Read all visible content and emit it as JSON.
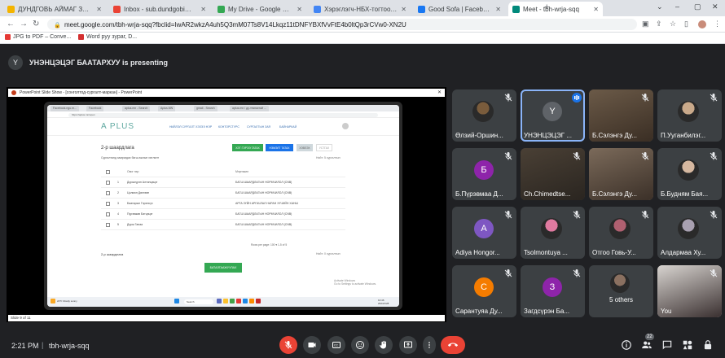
{
  "tabs": [
    {
      "label": "ДУНДГОВЬ АЙМАГ ЗДТГ",
      "favicon_color": "#f4b400",
      "active": false
    },
    {
      "label": "Inbox - sub.dundgobi@gmai",
      "favicon_color": "#ea4335",
      "active": false
    },
    {
      "label": "My Drive - Google Drive",
      "favicon_color": "#34a853",
      "active": false
    },
    {
      "label": "Хэрэглэгч-НБХ-тогтоол-III-у",
      "favicon_color": "#4285f4",
      "active": false
    },
    {
      "label": "Good Sofa | Facebook",
      "favicon_color": "#1877f2",
      "active": false
    },
    {
      "label": "Meet - tbh-wrja-sqq",
      "favicon_color": "#00897b",
      "active": true
    }
  ],
  "address": {
    "url": "meet.google.com/tbh-wrja-sqq?fbclid=IwAR2wkzA4uh5Q3mM07Ts8V14Lkqz11tDNFYBXfVvFtE4b0ltQp3rCVw0-XN2U"
  },
  "bookmarks": [
    {
      "label": "JPG to PDF – Conve...",
      "color": "#e53935"
    },
    {
      "label": "Word руу зураг, D...",
      "color": "#d32f2f"
    }
  ],
  "presenter": {
    "initial": "Y",
    "text": "УНЭНЦЭЦЭГ БААТАРХУУ is presenting"
  },
  "shared_screen": {
    "window_title": "PowerPoint Slide Show - [сонголтод-сургалт-маркан] - PowerPoint",
    "status": "Slide 9 of 11",
    "browser_tabs": [
      "Facebook.ngu.m...",
      "Facebook",
      "aplus.mn - Search",
      "Aplus.MN",
      "gmail - Search",
      "aplus.mn / ду-текниктай ..."
    ],
    "browser_url": "https://aplus.mn/open",
    "logo": "A PLUS",
    "nav": [
      "НИЙЛЭЛ СУРГАЛТ",
      "ХЭЗЭЭ НЭР",
      "КОНТОРСТУРС",
      "СУРГАЛТЫН ЗАЯ",
      "БАЙНАРКАЙ"
    ],
    "section_title": "2-р шаардлага",
    "buttons": [
      {
        "label": "ХЭТ ГЭРЭЭ ТАТАХ",
        "color": "#34a853"
      },
      {
        "label": "НЭМЭЛТ ТАТАХ",
        "color": "#1a73e8"
      },
      {
        "label": "ХЭВЛЭХ",
        "color": "#cfd8dc"
      },
      {
        "label": "УСТГАХ",
        "color": "#ffffff"
      }
    ],
    "subtitle": "Сургалтанд хамрагдах багш ажлын хөтлөлт",
    "subtitle_right": "Нийт: 5 сургалтын",
    "table_header": [
      "Овог нэр",
      "Мэргэжил"
    ],
    "rows": [
      {
        "n": "1",
        "name": "Доржсүрэн Алтанцэцэг",
        "major": "БАГШ ШААРДЛАГЫН НОРМЧИЛОЛ (CNB)"
      },
      {
        "n": "2",
        "name": "Цолмон Дөлгөөн",
        "major": "БАГШ ШААРДЛАГЫН НОРМЧИЛОЛ (CNB)"
      },
      {
        "n": "3",
        "name": "Баатарын Гэрэлсүх",
        "major": "АРГА ЗҮЙН АРГАЧЛАЛ НАРАН ХҮЧИЙН ХАНШ"
      },
      {
        "n": "4",
        "name": "Пүрэвжав Батцэцэг",
        "major": "БАГШ ШААРДЛАГЫН НОРМЧИЛОЛ (CNB)"
      },
      {
        "n": "5",
        "name": "Дорж Ганаа",
        "major": "БАГШ ШААРДЛАГЫН НОРМЧИЛОЛ (CNB)"
      }
    ],
    "pager": "Rows per page: 100 ▾   1-5 of 5",
    "section2_title": "2-р шаардлага",
    "section2_right": "Нийт: 0 сургалтын",
    "confirm_button": "БАТАЛГААЖУУЛАХ",
    "windows_activate": [
      "Activate Windows",
      "Go to Settings to activate Windows."
    ],
    "taskbar_search": "Search",
    "taskbar_weather": "22°F Mostly sunny",
    "taskbar_clock": [
      "10:46",
      "2024/1/28"
    ]
  },
  "participants": [
    {
      "name": "Өлзий-Оршин...",
      "initial": "",
      "kind": "photo",
      "bg": "#3c4043",
      "color": "#7a5c3c",
      "muted": true
    },
    {
      "name": "УНЭНЦЭЦЭГ ...",
      "initial": "Y",
      "kind": "speaking",
      "bg": "#3c4043",
      "color": "#5f6368",
      "muted": false
    },
    {
      "name": "Б.Сэлэнгэ Ду...",
      "initial": "",
      "kind": "video",
      "bg": "#6b5a48",
      "color": "#3a2e24",
      "muted": true
    },
    {
      "name": "П.Ууганбилэг...",
      "initial": "",
      "kind": "photo",
      "bg": "#3c4043",
      "color": "#c9a98a",
      "muted": true
    },
    {
      "name": "Б.Пүрэвмаа Д...",
      "initial": "Б",
      "kind": "avatar",
      "bg": "#3c4043",
      "color": "#8e24aa",
      "muted": true
    },
    {
      "name": "Ch.Chimedtse...",
      "initial": "",
      "kind": "video",
      "bg": "#4a4035",
      "color": "#2a2520",
      "muted": true
    },
    {
      "name": "Б.Сэлэнгэ Ду...",
      "initial": "",
      "kind": "video",
      "bg": "#7b6a5a",
      "color": "#3b3028",
      "muted": true
    },
    {
      "name": "Б.Будням Бая...",
      "initial": "",
      "kind": "photo",
      "bg": "#3c4043",
      "color": "#d6b8a0",
      "muted": true
    },
    {
      "name": "Adiya Hongor...",
      "initial": "A",
      "kind": "avatar",
      "bg": "#3c4043",
      "color": "#7e57c2",
      "muted": true
    },
    {
      "name": "Tsolmontuya ...",
      "initial": "",
      "kind": "photo",
      "bg": "#3c4043",
      "color": "#e07aa0",
      "muted": true
    },
    {
      "name": "Отгоо Говь-У...",
      "initial": "",
      "kind": "photo",
      "bg": "#3c4043",
      "color": "#b06070",
      "muted": true
    },
    {
      "name": "Алдармаа Ху...",
      "initial": "",
      "kind": "photo",
      "bg": "#3c4043",
      "color": "#a8a0b0",
      "muted": true
    },
    {
      "name": "Сарантуяа Ду...",
      "initial": "С",
      "kind": "avatar",
      "bg": "#3c4043",
      "color": "#f57c00",
      "muted": true
    },
    {
      "name": "Загдсүрэн Ба...",
      "initial": "З",
      "kind": "avatar",
      "bg": "#3c4043",
      "color": "#8e24aa",
      "muted": true
    },
    {
      "name": "",
      "initial": "",
      "kind": "more",
      "bg": "#3c4043",
      "color": "#8a7060",
      "muted": false,
      "more_label": "5 others"
    },
    {
      "name": "You",
      "initial": "",
      "kind": "self",
      "bg": "#d8d4d0",
      "color": "#3a3030",
      "muted": true
    }
  ],
  "meeting": {
    "time": "2:21 PM",
    "separator": "|",
    "code": "tbh-wrja-sqq",
    "participant_count": "22"
  }
}
